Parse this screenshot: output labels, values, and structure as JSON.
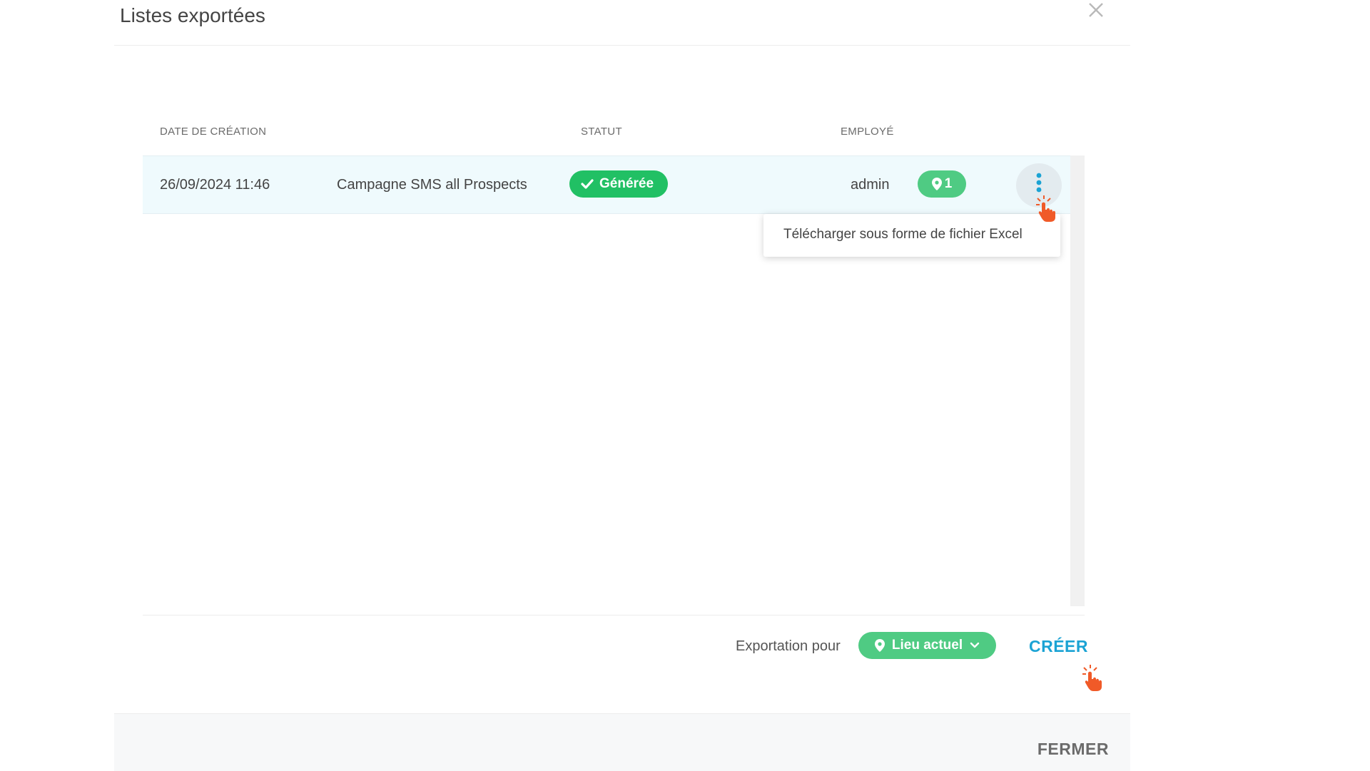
{
  "modal": {
    "title": "Listes exportées",
    "close_icon": "close-icon"
  },
  "table": {
    "columns": [
      "DATE DE CRÉATION",
      "",
      "STATUT",
      "EMPLOYÉ"
    ],
    "rows": [
      {
        "date": "26/09/2024 11:46",
        "name": "Campagne SMS all Prospects",
        "status": "Générée",
        "employee": "admin",
        "locations_count": "1"
      }
    ]
  },
  "row_menu": {
    "items": [
      "Télécharger sous forme de fichier Excel"
    ]
  },
  "footer_controls": {
    "export_label": "Exportation pour",
    "location_select": "Lieu actuel",
    "create_label": "CRÉER"
  },
  "modal_footer": {
    "close_label": "FERMER"
  },
  "colors": {
    "accent": "#1ba3d4",
    "status_green": "#21c064",
    "badge_green": "#4fcb83",
    "row_highlight": "#effafd",
    "cursor": "#f05a28"
  },
  "icons": {
    "status": "check-icon",
    "location": "map-pin-icon",
    "menu": "vertical-dots-icon",
    "dropdown": "chevron-down-icon",
    "pointer": "hand-pointer-icon"
  }
}
